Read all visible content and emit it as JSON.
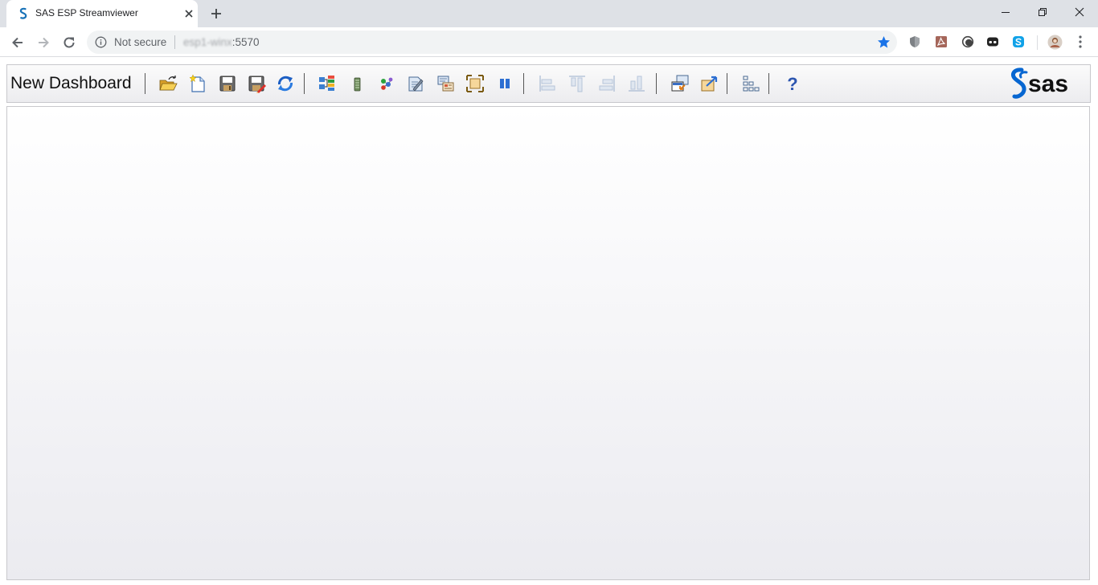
{
  "browser": {
    "tab": {
      "title": "SAS ESP Streamviewer",
      "favicon": "sas-s-icon"
    },
    "address": {
      "security_label": "Not secure",
      "url_host_obscured": "esp1-winx",
      "url_port": ":5570"
    },
    "extensions": [
      "shield-extension-icon",
      "pdf-extension-icon",
      "circle-extension-icon",
      "mask-extension-icon",
      "skype-extension-icon",
      "profile-avatar"
    ]
  },
  "app": {
    "dashboard_title": "New Dashboard",
    "brand": "sas",
    "toolbar_groups": [
      [
        "open-icon",
        "new-icon",
        "save-icon",
        "save-as-icon",
        "refresh-icon"
      ],
      [
        "windows-icon",
        "datasource-icon",
        "nodes-icon",
        "edit-icon",
        "properties-icon",
        "fit-icon",
        "pause-icon"
      ],
      [
        "align-left-icon",
        "align-top-icon",
        "align-right-icon",
        "align-bottom-icon"
      ],
      [
        "import-icon",
        "export-icon"
      ],
      [
        "layout-icon"
      ],
      [
        "help-icon"
      ]
    ]
  },
  "colors": {
    "accent_blue": "#1a73e8",
    "sas_blue": "#0766d1"
  }
}
